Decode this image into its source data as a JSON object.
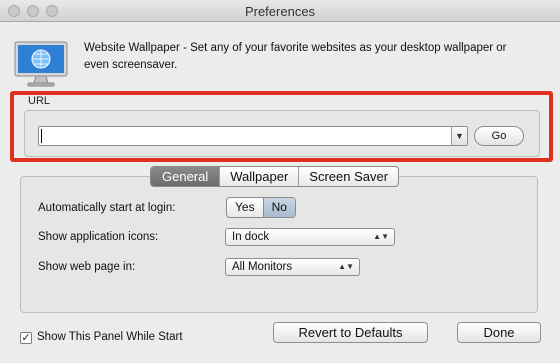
{
  "window": {
    "title": "Preferences"
  },
  "header": {
    "description": "Website Wallpaper - Set any of your favorite websites as your desktop wallpaper or even screensaver.",
    "icon": "monitor-globe-icon"
  },
  "url_section": {
    "label": "URL",
    "input_value": "",
    "go_label": "Go",
    "highlight_color": "#e0301e"
  },
  "tabs": [
    {
      "label": "General",
      "active": true
    },
    {
      "label": "Wallpaper",
      "active": false
    },
    {
      "label": "Screen Saver",
      "active": false
    }
  ],
  "general": {
    "auto_start": {
      "label": "Automatically start at login:",
      "options": [
        "Yes",
        "No"
      ],
      "selected": "No"
    },
    "show_icons": {
      "label": "Show application icons:",
      "value": "In dock"
    },
    "show_web_page": {
      "label": "Show web page in:",
      "value": "All Monitors"
    }
  },
  "footer": {
    "checkbox_label": "Show This Panel While Start",
    "checkbox_checked": true,
    "revert_label": "Revert to Defaults",
    "done_label": "Done"
  }
}
